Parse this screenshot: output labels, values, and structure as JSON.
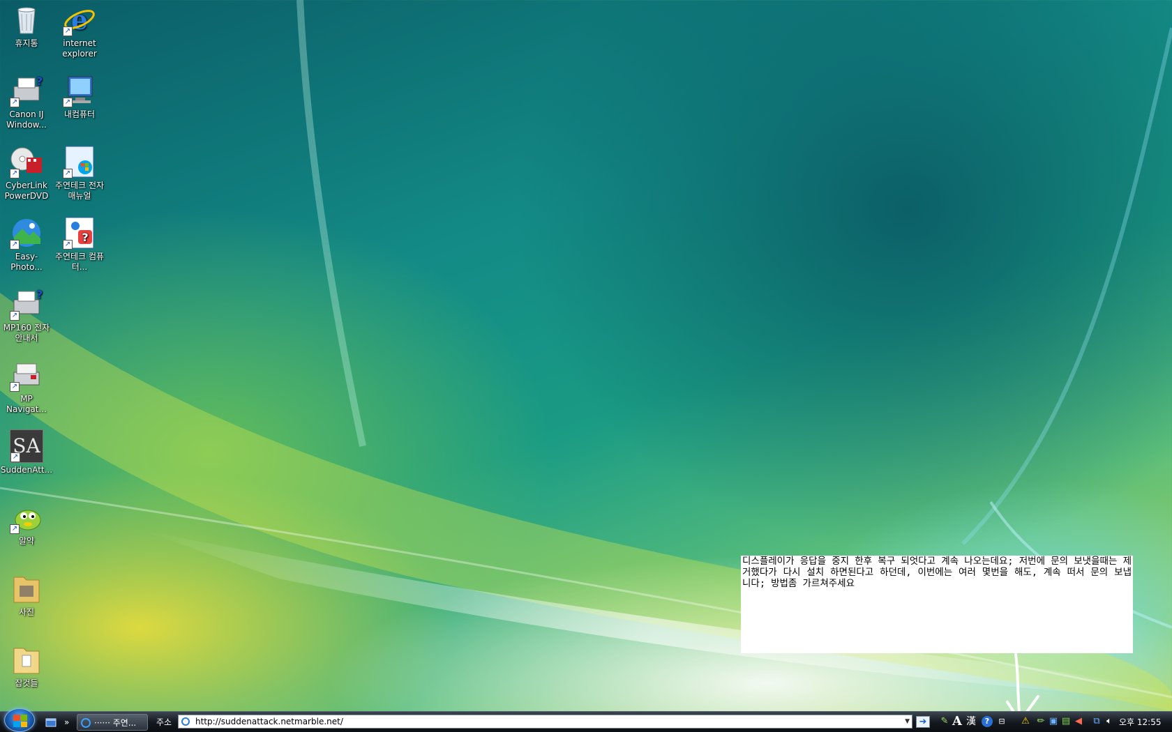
{
  "desktop": {
    "icons": [
      {
        "label": "휴지통",
        "icon": "recycle-bin-icon"
      },
      {
        "label": "internet explorer",
        "icon": "internet-explorer-icon"
      },
      {
        "label": "Canon IJ Window...",
        "icon": "canon-printer-icon"
      },
      {
        "label": "내컴퓨터",
        "icon": "computer-icon"
      },
      {
        "label": "CyberLink PowerDVD",
        "icon": "powerdvd-icon"
      },
      {
        "label": "주연테크 전자 매뉴얼",
        "icon": "manual-icon"
      },
      {
        "label": "Easy-Photo...",
        "icon": "easy-photo-icon"
      },
      {
        "label": "주연테크 컴퓨터...",
        "icon": "help-icon"
      },
      {
        "label": "MP160 전자 안내서",
        "icon": "printer-manual-icon"
      },
      {
        "label": "MP Navigat...",
        "icon": "mp-navigator-icon"
      },
      {
        "label": "SuddenAtt...",
        "icon": "sudden-attack-icon"
      },
      {
        "label": "알약",
        "icon": "alyac-icon"
      },
      {
        "label": "사진",
        "icon": "folder-icon"
      },
      {
        "label": "잡것들",
        "icon": "folder-icon"
      }
    ],
    "sa_logo_text": "SA"
  },
  "note": {
    "text": "디스플레이가 응답을 중지 한후 복구 되엇다고 계속 나오는데요; 저번에 문의 보냇을때는 제거했다가 다시 설치 하면된다고 하던데, 이번에는 여러 몇번을 해도, 계속 떠서 문의 보냅니다; 방법좀 가르쳐주세요"
  },
  "taskbar": {
    "quicklaunch_chevron": "»",
    "task_button_label": "······ 주연...",
    "address_label": "주소",
    "address_value": "http://suddenattack.netmarble.net/",
    "clock": "오후 12:55",
    "tray_icons": [
      "ime-icon",
      "font-a-icon",
      "hanja-icon",
      "help-icon",
      "display-settings-icon",
      "warning-icon",
      "pencil-icon",
      "network-icon",
      "speaker-icon",
      "volume-icon"
    ]
  },
  "colors": {
    "annotation": "#ffffff",
    "taskbar": "#151a20"
  }
}
